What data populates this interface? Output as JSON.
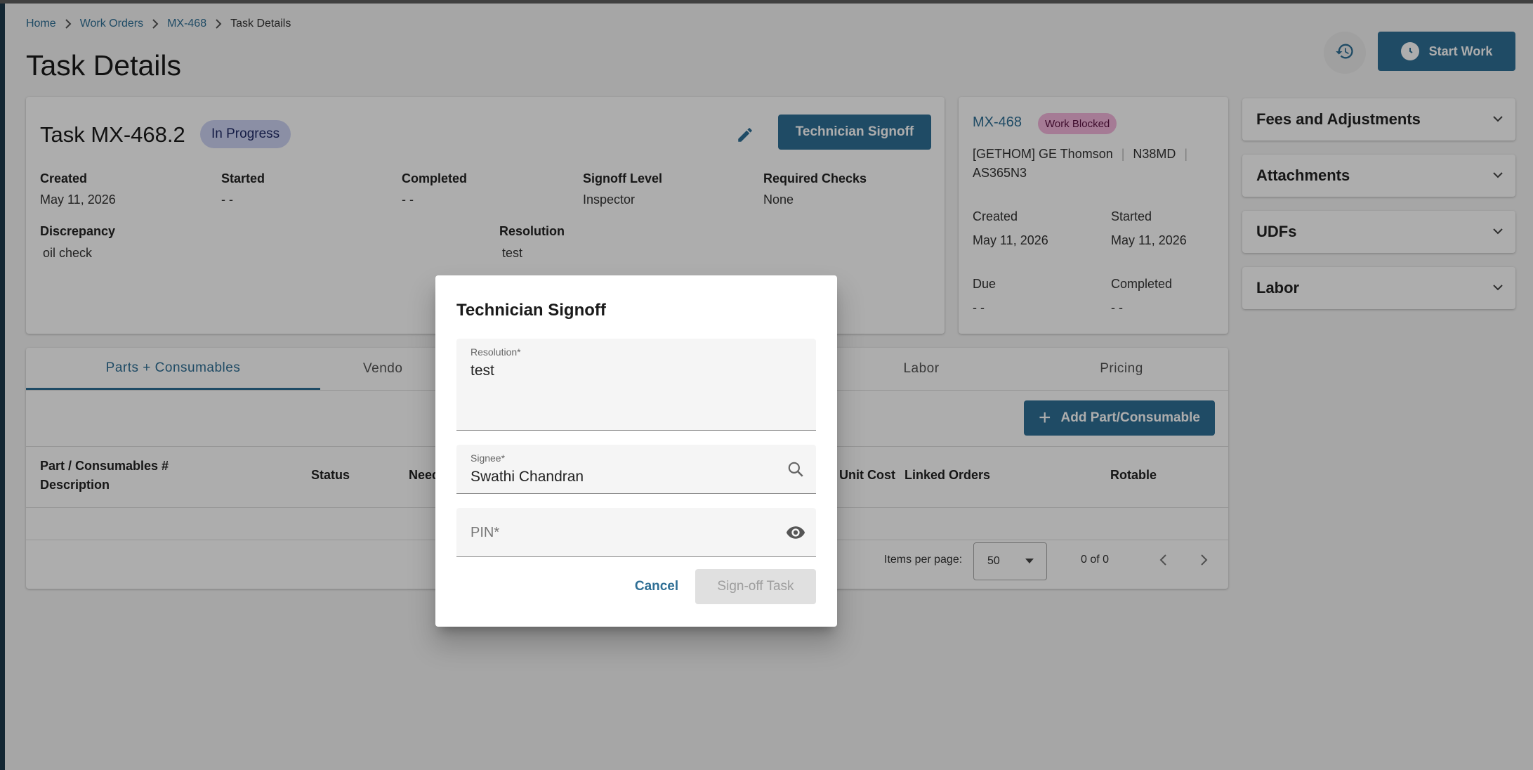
{
  "breadcrumb": {
    "items": [
      {
        "label": "Home"
      },
      {
        "label": "Work Orders"
      },
      {
        "label": "MX-468"
      }
    ],
    "current": "Task Details"
  },
  "header": {
    "title": "Task Details",
    "history_icon": "history-icon",
    "start_work_label": "Start Work",
    "start_work_icon": "clock-icon"
  },
  "task": {
    "title": "Task MX-468.2",
    "status": "In Progress",
    "edit_icon": "pencil-icon",
    "signoff_label": "Technician Signoff",
    "fields": {
      "created_label": "Created",
      "created_value": "May 11, 2026",
      "started_label": "Started",
      "started_value": "- -",
      "completed_label": "Completed",
      "completed_value": "- -",
      "signoff_level_label": "Signoff Level",
      "signoff_level_value": "Inspector",
      "required_checks_label": "Required Checks",
      "required_checks_value": "None",
      "discrepancy_label": "Discrepancy",
      "discrepancy_value": "oil check",
      "resolution_label": "Resolution",
      "resolution_value": "test"
    }
  },
  "work_order": {
    "id": "MX-468",
    "status": "Work Blocked",
    "customer": "[GETHOM] GE Thomson",
    "tail": "N38MD",
    "model": "AS365N3",
    "created_label": "Created",
    "created_value": "May 11, 2026",
    "started_label": "Started",
    "started_value": "May 11, 2026",
    "due_label": "Due",
    "due_value": "- -",
    "completed_label": "Completed",
    "completed_value": "- -"
  },
  "side_panels": [
    {
      "label": "Fees and Adjustments"
    },
    {
      "label": "Attachments"
    },
    {
      "label": "UDFs"
    },
    {
      "label": "Labor"
    }
  ],
  "tabs": [
    {
      "label": "Parts + Consumables",
      "active": true
    },
    {
      "label": "Vendo"
    },
    {
      "label": "Labor"
    },
    {
      "label": "Pricing"
    }
  ],
  "parts": {
    "add_label": "Add Part/Consumable",
    "columns": {
      "part": "Part / Consumables #",
      "description": "Description",
      "status": "Status",
      "need": "Need",
      "unit_cost": "Unit Cost",
      "linked_orders": "Linked Orders",
      "rotable": "Rotable"
    },
    "pager": {
      "items_per_page_label": "Items per page:",
      "page_size": "50",
      "range": "0 of 0"
    }
  },
  "dialog": {
    "title": "Technician Signoff",
    "resolution_label": "Resolution*",
    "resolution_value": "test",
    "signee_label": "Signee*",
    "signee_value": "Swathi Chandran",
    "pin_placeholder": "PIN*",
    "cancel_label": "Cancel",
    "submit_label": "Sign-off Task"
  },
  "colors": {
    "accent": "#2f6f95",
    "in_progress_chip": "#cdd3f3",
    "work_blocked_chip": "#f3b6dc",
    "disabled_button": "#e0e0e0"
  }
}
